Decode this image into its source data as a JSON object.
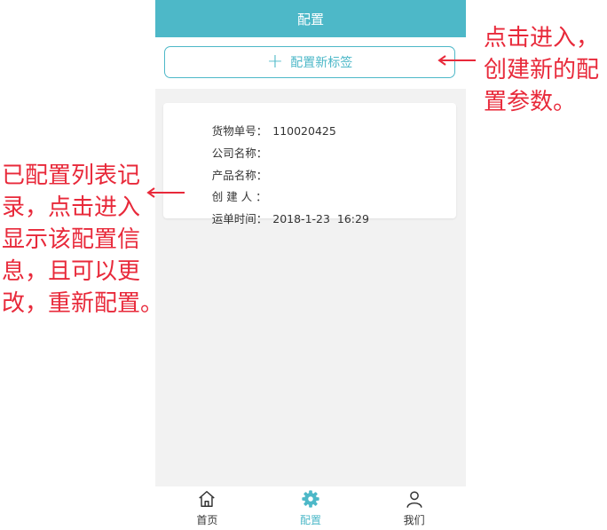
{
  "header": {
    "title": "配置"
  },
  "add_button": {
    "label": "配置新标签",
    "icon": "plus-icon"
  },
  "record": {
    "fields": [
      {
        "label": "货物单号：",
        "value": "110020425"
      },
      {
        "label": "公司名称：",
        "value": ""
      },
      {
        "label": "产品名称：",
        "value": ""
      },
      {
        "label": "创 建 人 ：",
        "value": ""
      },
      {
        "label": "运单时间：",
        "value": "2018-1-23  16:29"
      }
    ]
  },
  "tabbar": {
    "tabs": [
      {
        "label": "首页",
        "icon": "home-icon",
        "active": false
      },
      {
        "label": "配置",
        "icon": "gear-icon",
        "active": true
      },
      {
        "label": "我们",
        "icon": "user-icon",
        "active": false
      }
    ]
  },
  "annotations": {
    "right_lines": [
      "点击进入，",
      "创建新的配",
      "置参数。"
    ],
    "left_lines": [
      "已配置列表记",
      "录，点击进入",
      "显示该配置信",
      "息，且可以更",
      "改，重新配置。"
    ]
  },
  "colors": {
    "accent": "#4db8c8",
    "annotation": "#e8293a",
    "content_bg": "#f2f2f2"
  }
}
